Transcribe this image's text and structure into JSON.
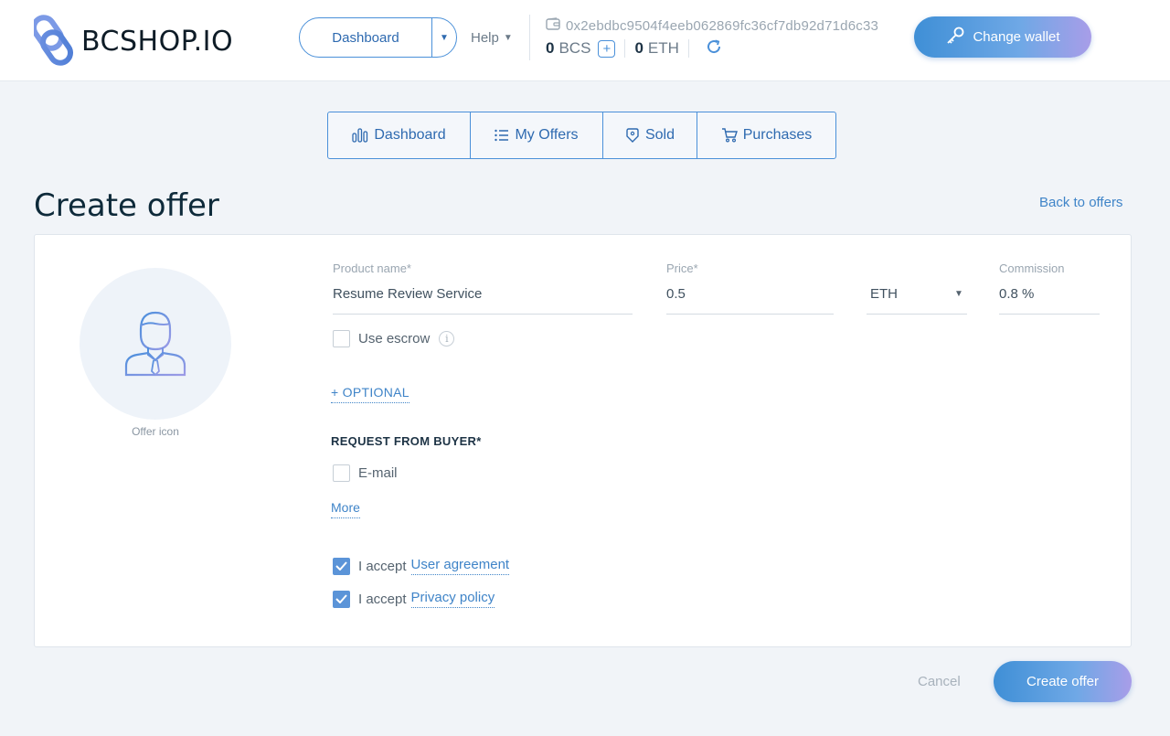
{
  "header": {
    "brand": "BCSHOP.IO",
    "dashboard_select": "Dashboard",
    "help": "Help",
    "wallet_address": "0x2ebdbc9504f4eeb062869fc36cf7db92d71d6c33",
    "bcs_amount": "0",
    "bcs_unit": "BCS",
    "eth_amount": "0",
    "eth_unit": "ETH",
    "change_wallet": "Change wallet"
  },
  "tabs": [
    {
      "label": "Dashboard",
      "icon": "bar-chart-icon"
    },
    {
      "label": "My Offers",
      "icon": "list-icon"
    },
    {
      "label": "Sold",
      "icon": "tag-icon"
    },
    {
      "label": "Purchases",
      "icon": "cart-icon"
    }
  ],
  "page": {
    "title": "Create offer",
    "back_link": "Back to offers"
  },
  "form": {
    "offer_icon_label": "Offer icon",
    "product_name_label": "Product name*",
    "product_name_value": "Resume Review Service",
    "price_label": "Price*",
    "price_value": "0.5",
    "currency_value": "ETH",
    "commission_label": "Commission",
    "commission_value": "0.8 %",
    "use_escrow_label": "Use escrow",
    "use_escrow_checked": false,
    "optional_link": "+ OPTIONAL",
    "request_title": "REQUEST FROM BUYER*",
    "email_label": "E-mail",
    "email_checked": false,
    "more_link": "More",
    "accept_prefix_1": "I accept",
    "user_agreement_link": "User agreement",
    "user_agreement_checked": true,
    "accept_prefix_2": "I accept",
    "privacy_policy_link": "Privacy policy",
    "privacy_policy_checked": true
  },
  "actions": {
    "cancel": "Cancel",
    "create": "Create offer"
  },
  "colors": {
    "accent": "#4a90d9",
    "title": "#0e2a3a",
    "background": "#f1f4f8"
  }
}
